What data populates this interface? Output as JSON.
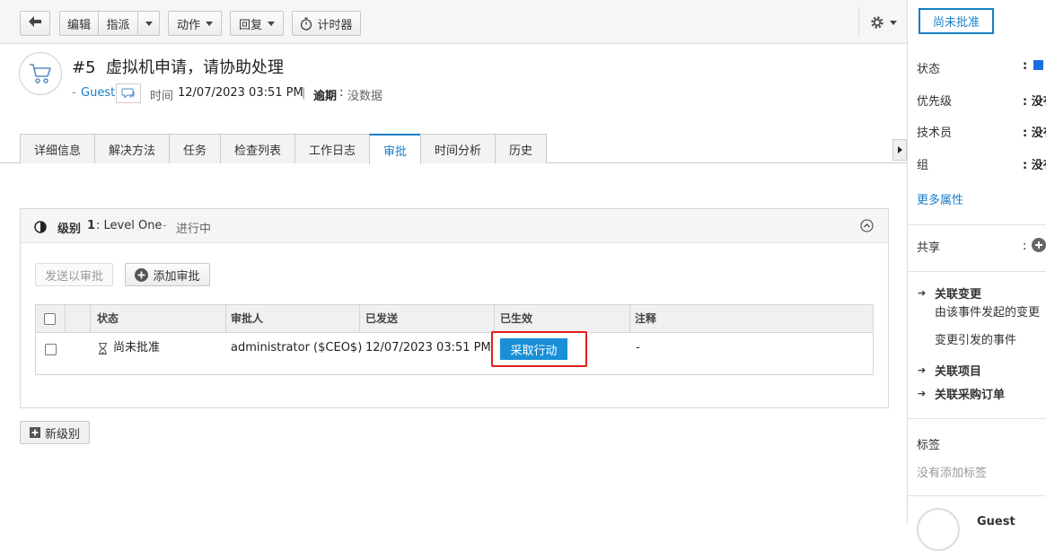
{
  "toolbar": {
    "back_label": "",
    "edit_label": "编辑",
    "assign_label": "指派",
    "actions_label": "动作",
    "reply_label": "回复",
    "timer_label": "计时器"
  },
  "status_button": "尚未批准",
  "request": {
    "title": "#5  虚拟机申请，请协助处理",
    "dash": "-",
    "requester": "Guest",
    "time_label": "时间",
    "time_value": "12/07/2023 03:51 PM",
    "separator": "|",
    "due_label": "逾期",
    "due_colon": ":",
    "due_value": "没数据"
  },
  "tabs": [
    "详细信息",
    "解决方法",
    "任务",
    "检查列表",
    "工作日志",
    "审批",
    "时间分析",
    "历史"
  ],
  "active_tab": "审批",
  "level": {
    "label": "级别",
    "number": "1",
    "name": ": Level One",
    "dash": "-",
    "status": "进行中",
    "send_button": "发送以审批",
    "add_button": "添加审批"
  },
  "approval_table": {
    "headers": [
      "状态",
      "审批人",
      "已发送",
      "已生效",
      "注释"
    ],
    "rows": [
      {
        "status": "尚未批准",
        "approver": "administrator ($CEO$)",
        "sent": "12/07/2023 03:51 PM",
        "action_button": "采取行动",
        "comment": "-"
      }
    ]
  },
  "new_level_button": "新级别",
  "sidebar": {
    "properties": [
      {
        "label": "状态",
        "value": ":"
      },
      {
        "label": "优先级",
        "value": ": 没有"
      },
      {
        "label": "技术员",
        "value": ": 没有"
      },
      {
        "label": "组",
        "value": ": 没有"
      }
    ],
    "more_properties": "更多属性",
    "share_label": "共享",
    "share_colon": ":",
    "related_changes": "关联变更",
    "change_from_incident": "由该事件发起的变更",
    "change_caused_incident": "变更引发的事件",
    "related_items": "关联项目",
    "related_po": "关联采购订单",
    "tags_label": "标签",
    "no_tags": "没有添加标签",
    "user_name": "Guest"
  },
  "colors": {
    "accent": "#1a7fc8",
    "action_button": "#1a8fd6",
    "highlight_border": "#e0201c",
    "status_square": "#1a6fe0"
  }
}
